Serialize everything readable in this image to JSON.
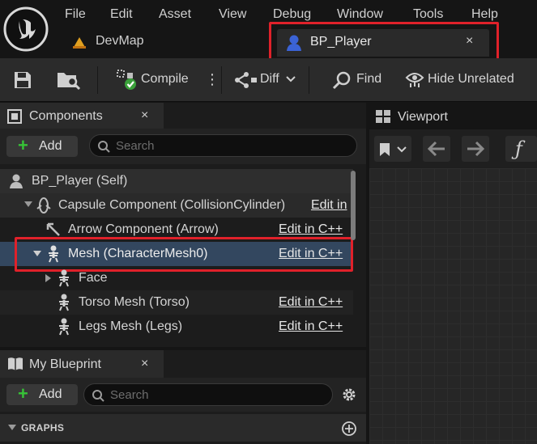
{
  "menu": [
    "File",
    "Edit",
    "Asset",
    "View",
    "Debug",
    "Window",
    "Tools",
    "Help"
  ],
  "tabs": [
    {
      "label": "DevMap",
      "close": ""
    },
    {
      "label": "BP_Player",
      "close": "×"
    }
  ],
  "toolbar": {
    "compile_label": "Compile",
    "diff_label": "Diff",
    "find_label": "Find",
    "hide_unrelated_label": "Hide Unrelated",
    "more_glyph": "⋮"
  },
  "components": {
    "title": "Components",
    "close": "×",
    "add_label": "Add",
    "search_placeholder": "Search",
    "rows": [
      {
        "label": "BP_Player (Self)",
        "edit": ""
      },
      {
        "label": "Capsule Component (CollisionCylinder)",
        "edit": "Edit in"
      },
      {
        "label": "Arrow Component (Arrow)",
        "edit": "Edit in C++"
      },
      {
        "label": "Mesh (CharacterMesh0)",
        "edit": "Edit in C++"
      },
      {
        "label": "Face",
        "edit": ""
      },
      {
        "label": "Torso Mesh (Torso)",
        "edit": "Edit in C++"
      },
      {
        "label": "Legs Mesh (Legs)",
        "edit": "Edit in C++"
      }
    ]
  },
  "my_blueprint": {
    "title": "My Blueprint",
    "close": "×",
    "add_label": "Add",
    "search_placeholder": "Search",
    "graphs_label": "GRAPHS"
  },
  "viewport": {
    "title": "Viewport",
    "function_glyph": "ƒ"
  },
  "colors": {
    "highlight": "#e0212a",
    "selected_row": "#33475f",
    "add_plus": "#37c337",
    "bp_icon": "#3b63d6",
    "map_icon": "#e0a020"
  }
}
